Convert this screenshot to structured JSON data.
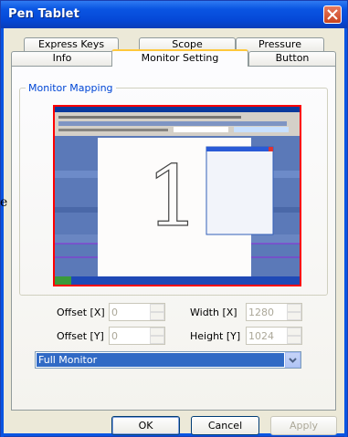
{
  "window": {
    "title": "Pen Tablet"
  },
  "tabs_row1": [
    {
      "label": "Express Keys"
    },
    {
      "label": "Scope"
    },
    {
      "label": "Pressure"
    }
  ],
  "tabs_row2": [
    {
      "label": "Info"
    },
    {
      "label": "Monitor Setting",
      "active": true
    },
    {
      "label": "Button"
    }
  ],
  "group": {
    "title": "Monitor Mapping"
  },
  "preview": {
    "monitor_number": "1"
  },
  "fields": {
    "offset_x": {
      "label": "Offset [X]",
      "value": "0"
    },
    "offset_y": {
      "label": "Offset [Y]",
      "value": "0"
    },
    "width_x": {
      "label": "Width [X]",
      "value": "1280"
    },
    "height_y": {
      "label": "Height [Y]",
      "value": "1024"
    }
  },
  "mapping_select": {
    "selected": "Full Monitor"
  },
  "buttons": {
    "ok": "OK",
    "cancel": "Cancel",
    "apply": "Apply"
  },
  "edge_text": "e",
  "colors": {
    "title_bar": "#0a55e2",
    "selection": "#316ac5",
    "preview_border": "#ff0000",
    "tab_accent": "#ffc83c"
  }
}
